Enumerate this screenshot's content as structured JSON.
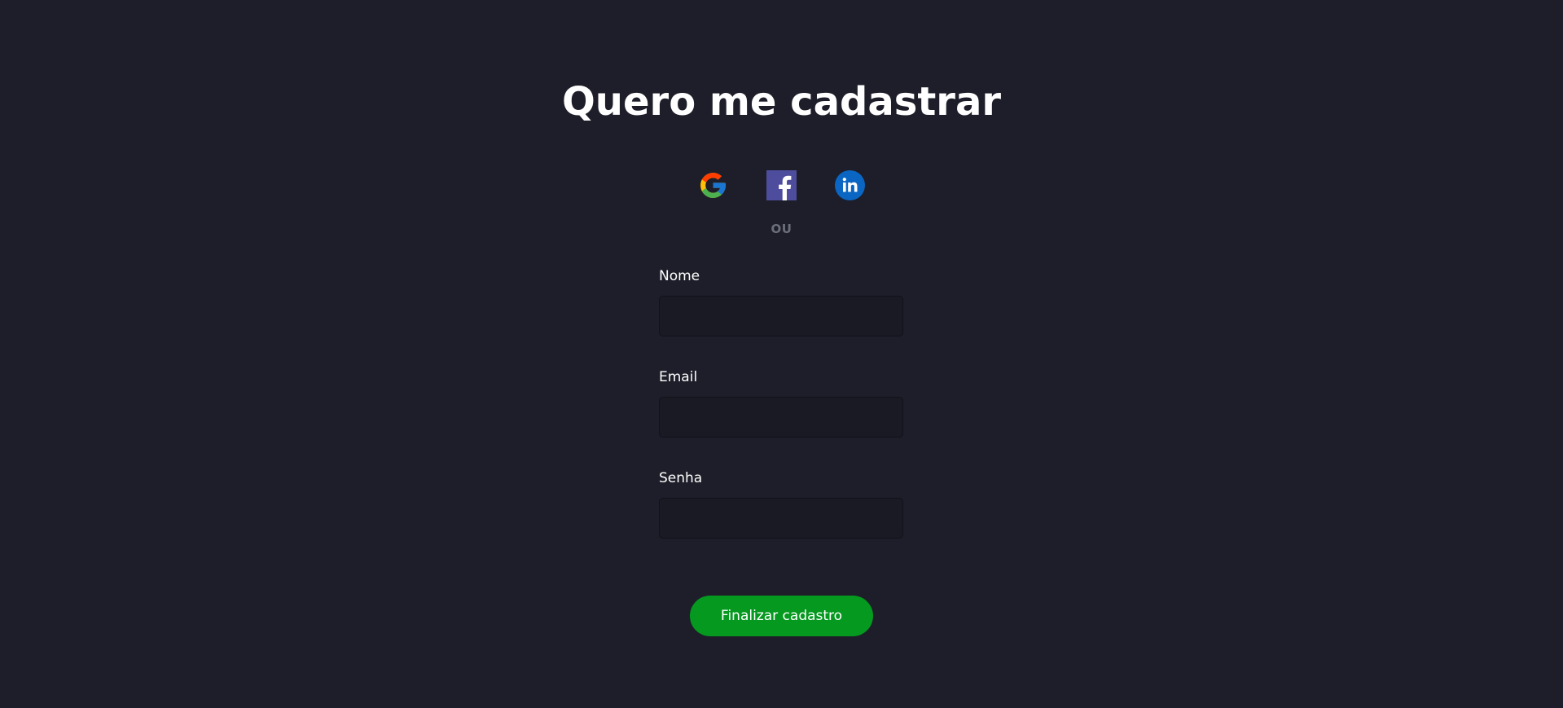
{
  "title": "Quero me cadastrar",
  "social": [
    {
      "name": "google",
      "icon": "google-icon"
    },
    {
      "name": "facebook",
      "icon": "facebook-icon",
      "color": "#4e4c9c"
    },
    {
      "name": "linkedin",
      "icon": "linkedin-icon",
      "color": "#0a66c2"
    }
  ],
  "divider": "OU",
  "form": {
    "fields": [
      {
        "label": "Nome",
        "value": "",
        "type": "text"
      },
      {
        "label": "Email",
        "value": "",
        "type": "email"
      },
      {
        "label": "Senha",
        "value": "",
        "type": "password"
      }
    ],
    "submit_label": "Finalizar cadastro"
  },
  "colors": {
    "background": "#1d1e29",
    "input_background": "#191a24",
    "button": "#05991f",
    "divider_text": "#6c6e7a"
  }
}
